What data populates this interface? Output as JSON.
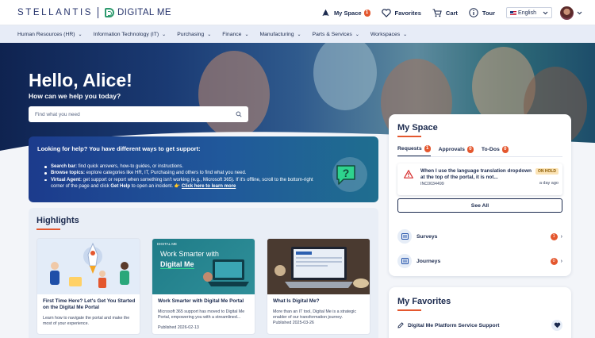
{
  "header": {
    "brand_primary": "STELLANTIS",
    "brand_secondary": "DIGITAL ME",
    "my_space_label": "My Space",
    "my_space_count": "1",
    "favorites_label": "Favorites",
    "cart_label": "Cart",
    "tour_label": "Tour",
    "language": "English"
  },
  "nav": {
    "items": [
      {
        "label": "Human Resources (HR)"
      },
      {
        "label": "Information Technology (IT)"
      },
      {
        "label": "Purchasing"
      },
      {
        "label": "Finance"
      },
      {
        "label": "Manufacturing"
      },
      {
        "label": "Parts & Services"
      },
      {
        "label": "Workspaces"
      }
    ]
  },
  "hero": {
    "greeting": "Hello, Alice!",
    "subtitle": "How can we help you today?",
    "search_placeholder": "Find what you need"
  },
  "help": {
    "title": "Looking for help? You have different ways to get support:",
    "items": [
      {
        "term": "Search bar:",
        "text": " find quick answers, how-to guides, or instructions."
      },
      {
        "term": "Browse topics:",
        "text": " explore categories like HR, IT, Purchasing and others to find what you need."
      },
      {
        "term": "Virtual Agent:",
        "text": " get support or report when something isn't working (e.g., Microsoft 365). If it's offline, scroll to the bottom-right corner of the page and click ",
        "term2": "Get Help",
        "text2": " to open an incident. 👉 ",
        "link": "Click here to learn more"
      }
    ]
  },
  "highlights": {
    "title": "Highlights",
    "cards": [
      {
        "title": "First Time Here? Let's Get You Started on the Digital Me Portal",
        "description": "Learn how to navigate the portal and make the most of your experience.",
        "date": ""
      },
      {
        "title": "Work Smarter with Digital Me Portal",
        "description": "Microsoft 365 support has moved to Digital Me Portal, empowering you with a streamlined...",
        "date": "Published 2026-02-13",
        "banner_line1": "Work Smarter with",
        "banner_line2": "Digital Me",
        "banner_logo": "DIGITAL ME"
      },
      {
        "title": "What Is Digital Me?",
        "description": "More than an IT tool, Digital Me is a strategic enabler of our transformation journey.",
        "date": "Published 2025-03-26"
      }
    ]
  },
  "my_space": {
    "title": "My Space",
    "tabs": [
      {
        "label": "Requests",
        "count": "1"
      },
      {
        "label": "Approvals",
        "count": "0"
      },
      {
        "label": "To-Dos",
        "count": "0"
      }
    ],
    "request": {
      "text": "When I use the language translation dropdown at the top of the portal, it is not...",
      "id": "INC0034499",
      "status": "ON HOLD",
      "time": "a day ago"
    },
    "see_all_label": "See All",
    "rows": [
      {
        "label": "Surveys",
        "count": "1"
      },
      {
        "label": "Journeys",
        "count": "0"
      }
    ]
  },
  "favorites": {
    "title": "My Favorites",
    "items": [
      {
        "label": "Digital Me Platform Service Support"
      }
    ]
  },
  "colors": {
    "brand_navy": "#1b2a4e",
    "accent_orange": "#e4572e",
    "help_blue": "#1c3b8c"
  }
}
